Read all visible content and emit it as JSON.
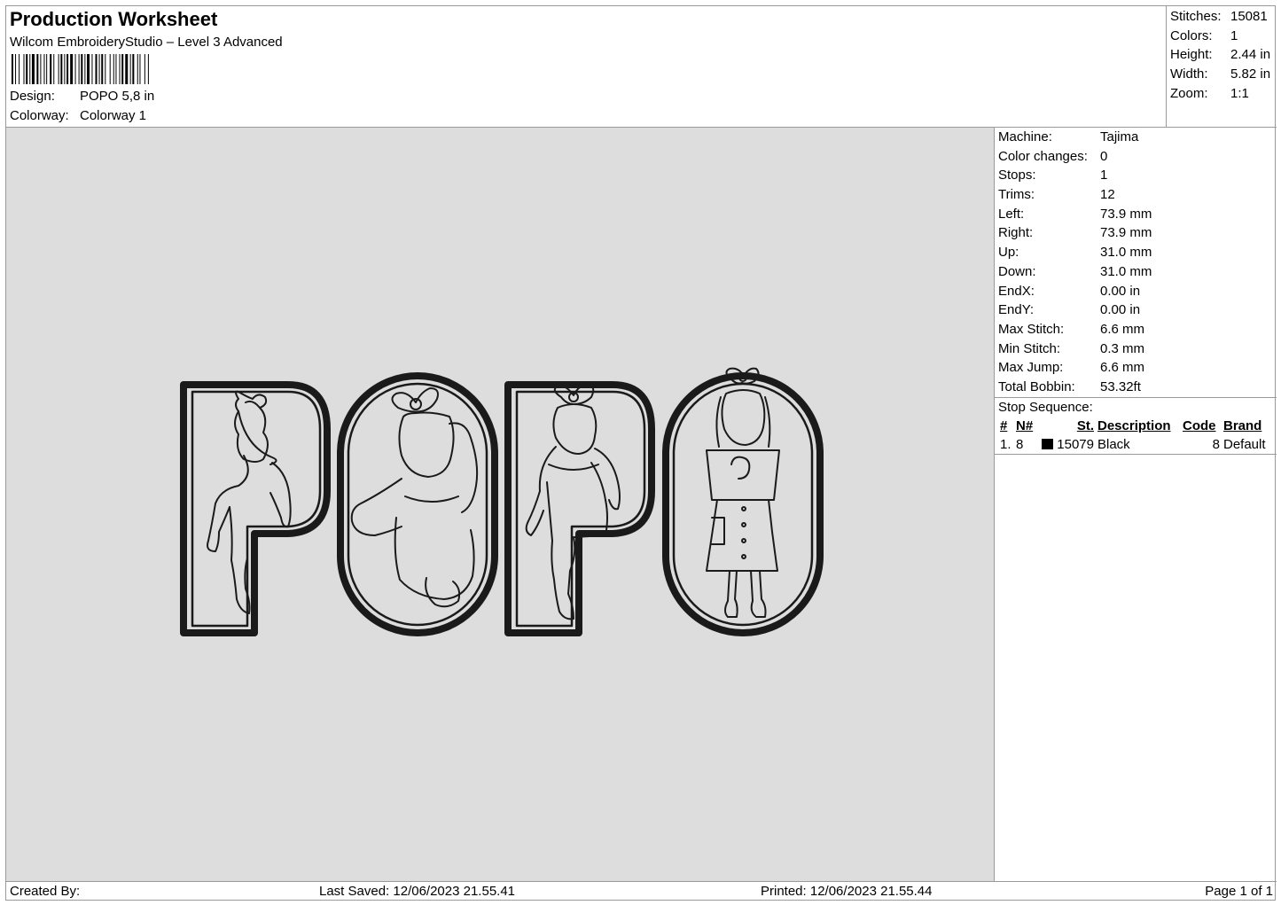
{
  "header": {
    "title": "Production Worksheet",
    "subtitle": "Wilcom EmbroideryStudio – Level 3 Advanced",
    "design_label": "Design:",
    "design_value": "POPO 5,8 in",
    "colorway_label": "Colorway:",
    "colorway_value": "Colorway 1"
  },
  "summary": [
    {
      "label": "Stitches:",
      "value": "15081"
    },
    {
      "label": "Colors:",
      "value": "1"
    },
    {
      "label": "Height:",
      "value": "2.44 in"
    },
    {
      "label": "Width:",
      "value": "5.82 in"
    },
    {
      "label": "Zoom:",
      "value": "1:1"
    }
  ],
  "properties": [
    {
      "label": "Machine:",
      "value": "Tajima"
    },
    {
      "label": "Color changes:",
      "value": "0"
    },
    {
      "label": "Stops:",
      "value": "1"
    },
    {
      "label": "Trims:",
      "value": "12"
    },
    {
      "label": "Left:",
      "value": "73.9 mm"
    },
    {
      "label": "Right:",
      "value": "73.9 mm"
    },
    {
      "label": "Up:",
      "value": "31.0 mm"
    },
    {
      "label": "Down:",
      "value": "31.0 mm"
    },
    {
      "label": "EndX:",
      "value": "0.00 in"
    },
    {
      "label": "EndY:",
      "value": "0.00 in"
    },
    {
      "label": "Max Stitch:",
      "value": "6.6 mm"
    },
    {
      "label": "Min Stitch:",
      "value": "0.3 mm"
    },
    {
      "label": "Max Jump:",
      "value": "6.6 mm"
    },
    {
      "label": "Total Bobbin:",
      "value": "53.32ft"
    }
  ],
  "stop_sequence": {
    "caption": "Stop Sequence:",
    "columns": [
      "#",
      "N#",
      "St.",
      "Description",
      "Code",
      "Brand"
    ],
    "rows": [
      {
        "index": "1.",
        "needle": "8",
        "swatch_color": "#000000",
        "stitches": "15079",
        "description": "Black",
        "code": "8",
        "brand": "Default"
      }
    ]
  },
  "design_preview": {
    "background": "#dddddd",
    "stitch_color": "#1a1a1a",
    "content": "POPO"
  },
  "footer": {
    "created_by": "Created By:",
    "last_saved": "Last Saved: 12/06/2023 21.55.41",
    "printed": "Printed: 12/06/2023 21.55.44",
    "page": "Page 1 of 1"
  }
}
